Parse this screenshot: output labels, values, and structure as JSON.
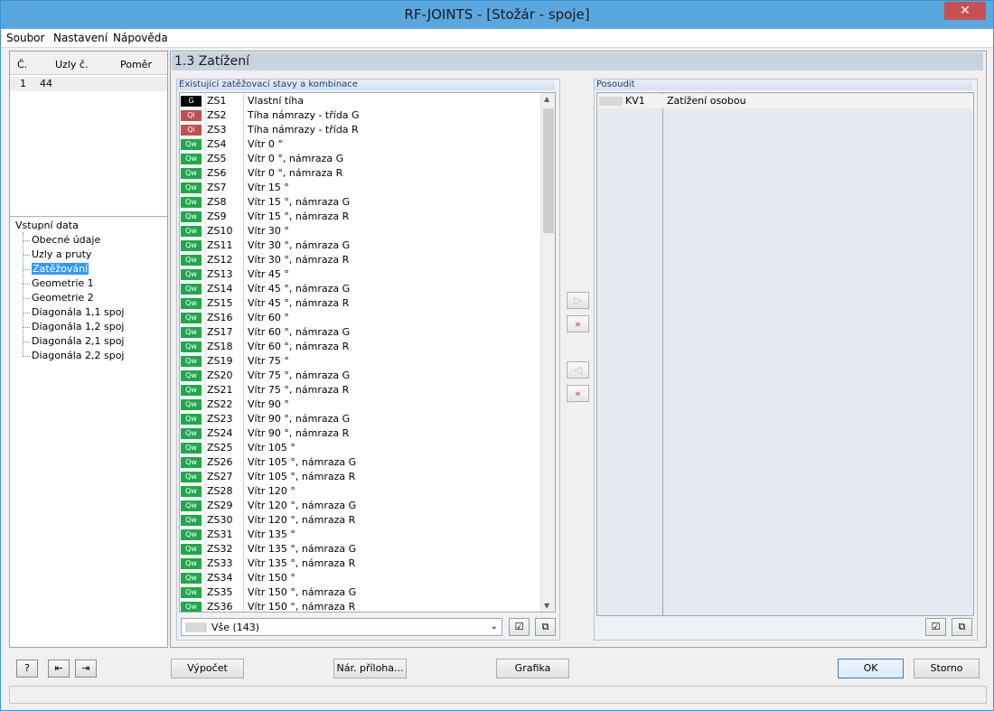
{
  "window": {
    "title": "RF-JOINTS - [Stožár - spoje]",
    "close": "✕"
  },
  "menu": [
    "Soubor",
    "Nastavení",
    "Nápověda"
  ],
  "left_table": {
    "headers": [
      "Č.",
      "Uzly č.",
      "Poměr"
    ],
    "rows": [
      {
        "no": "1",
        "nodes": "44",
        "ratio": ""
      }
    ]
  },
  "tree": {
    "root": "Vstupní data",
    "items": [
      "Obecné údaje",
      "Uzly a pruty",
      "Zatěžování",
      "Geometrie 1",
      "Geometrie 2",
      "Diagonála 1,1 spoj",
      "Diagonála 1,2 spoj",
      "Diagonála 2,1 spoj",
      "Diagonála 2,2 spoj"
    ],
    "selected_index": 2
  },
  "section_title": "1.3 Zatížení",
  "existing": {
    "header": "Existující zatěžovací stavy a kombinace",
    "rows": [
      {
        "badge": "G",
        "type": "g",
        "id": "ZS1",
        "desc": "Vlastní tíha"
      },
      {
        "badge": "Qi",
        "type": "qi",
        "id": "ZS2",
        "desc": "Tíha námrazy - třída G"
      },
      {
        "badge": "Qi",
        "type": "qi",
        "id": "ZS3",
        "desc": "Tíha námrazy - třída R"
      },
      {
        "badge": "Qw",
        "type": "qw",
        "id": "ZS4",
        "desc": "Vítr 0 °"
      },
      {
        "badge": "Qw",
        "type": "qw",
        "id": "ZS5",
        "desc": "Vítr 0 °, námraza G"
      },
      {
        "badge": "Qw",
        "type": "qw",
        "id": "ZS6",
        "desc": "Vítr 0 °, námraza R"
      },
      {
        "badge": "Qw",
        "type": "qw",
        "id": "ZS7",
        "desc": "Vítr 15 °"
      },
      {
        "badge": "Qw",
        "type": "qw",
        "id": "ZS8",
        "desc": "Vítr 15 °, námraza G"
      },
      {
        "badge": "Qw",
        "type": "qw",
        "id": "ZS9",
        "desc": "Vítr 15 °, námraza R"
      },
      {
        "badge": "Qw",
        "type": "qw",
        "id": "ZS10",
        "desc": "Vítr 30 °"
      },
      {
        "badge": "Qw",
        "type": "qw",
        "id": "ZS11",
        "desc": "Vítr 30 °, námraza G"
      },
      {
        "badge": "Qw",
        "type": "qw",
        "id": "ZS12",
        "desc": "Vítr 30 °, námraza R"
      },
      {
        "badge": "Qw",
        "type": "qw",
        "id": "ZS13",
        "desc": "Vítr 45 °"
      },
      {
        "badge": "Qw",
        "type": "qw",
        "id": "ZS14",
        "desc": "Vítr 45 °, námraza G"
      },
      {
        "badge": "Qw",
        "type": "qw",
        "id": "ZS15",
        "desc": "Vítr 45 °, námraza R"
      },
      {
        "badge": "Qw",
        "type": "qw",
        "id": "ZS16",
        "desc": "Vítr 60 °"
      },
      {
        "badge": "Qw",
        "type": "qw",
        "id": "ZS17",
        "desc": "Vítr 60 °, námraza G"
      },
      {
        "badge": "Qw",
        "type": "qw",
        "id": "ZS18",
        "desc": "Vítr 60 °, námraza R"
      },
      {
        "badge": "Qw",
        "type": "qw",
        "id": "ZS19",
        "desc": "Vítr 75 °"
      },
      {
        "badge": "Qw",
        "type": "qw",
        "id": "ZS20",
        "desc": "Vítr 75 °, námraza G"
      },
      {
        "badge": "Qw",
        "type": "qw",
        "id": "ZS21",
        "desc": "Vítr 75 °, námraza R"
      },
      {
        "badge": "Qw",
        "type": "qw",
        "id": "ZS22",
        "desc": "Vítr 90 °"
      },
      {
        "badge": "Qw",
        "type": "qw",
        "id": "ZS23",
        "desc": "Vítr 90 °, námraza G"
      },
      {
        "badge": "Qw",
        "type": "qw",
        "id": "ZS24",
        "desc": "Vítr 90 °, námraza R"
      },
      {
        "badge": "Qw",
        "type": "qw",
        "id": "ZS25",
        "desc": "Vítr 105 °"
      },
      {
        "badge": "Qw",
        "type": "qw",
        "id": "ZS26",
        "desc": "Vítr 105 °, námraza G"
      },
      {
        "badge": "Qw",
        "type": "qw",
        "id": "ZS27",
        "desc": "Vítr 105 °, námraza R"
      },
      {
        "badge": "Qw",
        "type": "qw",
        "id": "ZS28",
        "desc": "Vítr 120 °"
      },
      {
        "badge": "Qw",
        "type": "qw",
        "id": "ZS29",
        "desc": "Vítr 120 °, námraza G"
      },
      {
        "badge": "Qw",
        "type": "qw",
        "id": "ZS30",
        "desc": "Vítr 120 °, námraza R"
      },
      {
        "badge": "Qw",
        "type": "qw",
        "id": "ZS31",
        "desc": "Vítr 135 °"
      },
      {
        "badge": "Qw",
        "type": "qw",
        "id": "ZS32",
        "desc": "Vítr 135 °, námraza G"
      },
      {
        "badge": "Qw",
        "type": "qw",
        "id": "ZS33",
        "desc": "Vítr 135 °, námraza R"
      },
      {
        "badge": "Qw",
        "type": "qw",
        "id": "ZS34",
        "desc": "Vítr 150 °"
      },
      {
        "badge": "Qw",
        "type": "qw",
        "id": "ZS35",
        "desc": "Vítr 150 °, námraza G"
      },
      {
        "badge": "Qw",
        "type": "qw",
        "id": "ZS36",
        "desc": "Vítr 150 °, námraza R"
      }
    ],
    "filter_value": "Vše (143)"
  },
  "assess": {
    "header": "Posoudit",
    "rows": [
      {
        "id": "KV1",
        "desc": "Zatížení osobou"
      }
    ]
  },
  "buttons": {
    "calc": "Výpočet",
    "annex": "Nár. příloha...",
    "graphics": "Grafika",
    "ok": "OK",
    "cancel": "Storno"
  },
  "icons": {
    "badge_colors": {
      "g": "#000000",
      "qi": "#c0504d",
      "qw": "#1fa84a"
    }
  }
}
